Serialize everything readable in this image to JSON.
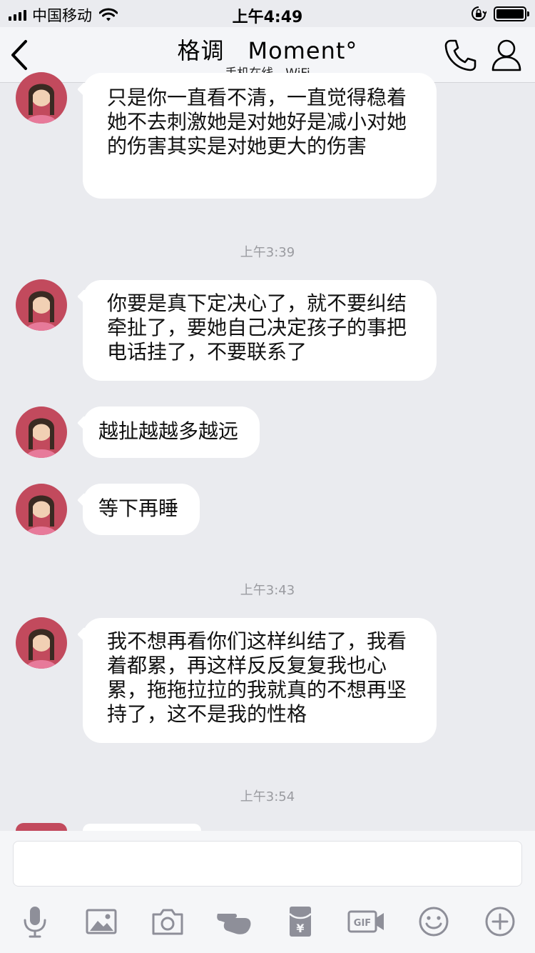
{
  "status_bar": {
    "carrier": "中国移动",
    "time": "上午4:49"
  },
  "header": {
    "title": "格调　Moment°",
    "subtitle": "手机在线 - WiFi"
  },
  "messages": [
    {
      "text": "只是你一直看不清，一直觉得稳着她不去刺激她是对她好是减小对她的伤害其实是对她更大的伤害"
    },
    {
      "timestamp": "上午3:39"
    },
    {
      "text": "你要是真下定决心了，就不要纠结牵扯了，要她自己决定孩子的事把电话挂了，不要联系了"
    },
    {
      "text": "越扯越越多越远"
    },
    {
      "text": "等下再睡"
    },
    {
      "timestamp": "上午3:43"
    },
    {
      "text": "我不想再看你们这样纠结了，我看着都累，再这样反反复复我也心累，拖拖拉拉的我就真的不想再坚持了，这不是我的性格"
    },
    {
      "timestamp": "上午3:54"
    }
  ],
  "input": {
    "value": "",
    "placeholder": ""
  },
  "toolbar": {
    "icons": [
      "microphone-icon",
      "image-icon",
      "camera-icon",
      "poke-hand-icon",
      "red-packet-icon",
      "gif-icon",
      "emoji-icon",
      "plus-icon"
    ],
    "gif_label": "GIF",
    "red_packet_label": "¥"
  },
  "colors": {
    "background": "#eaebef",
    "bubble": "#ffffff",
    "timestamp": "#9a9ba0",
    "icon": "#8e8f99"
  }
}
